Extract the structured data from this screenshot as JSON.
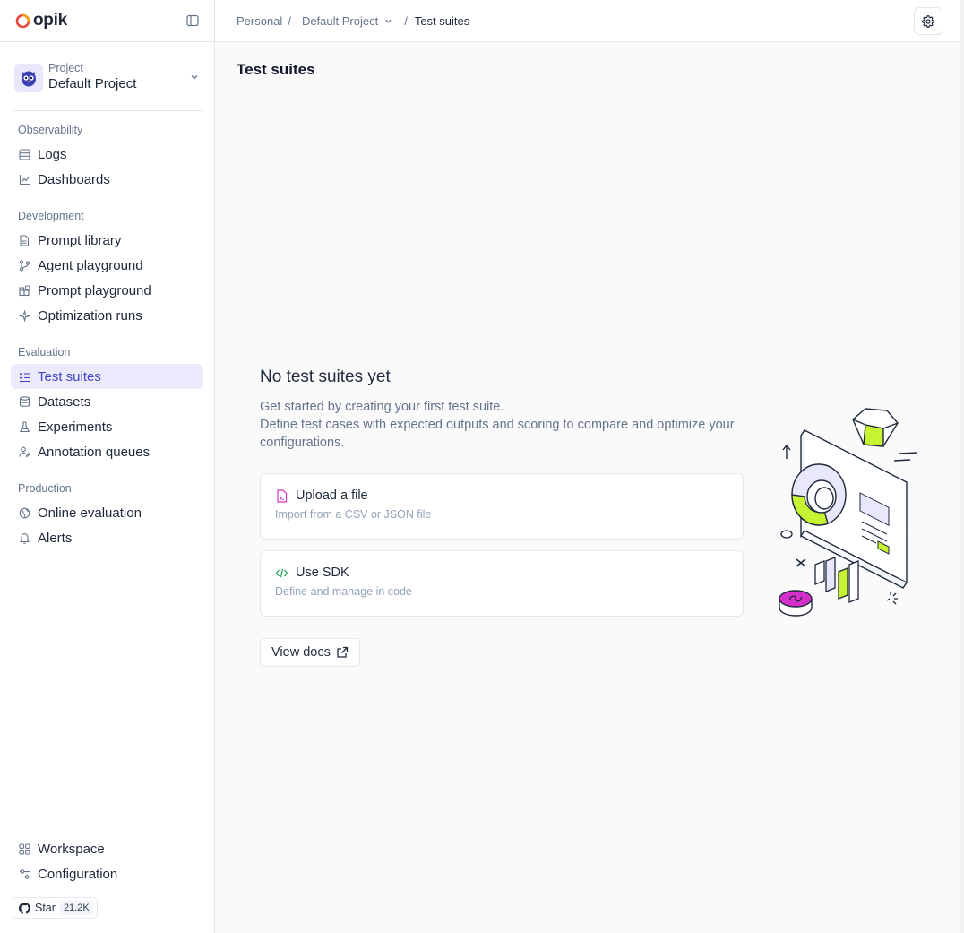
{
  "app": {
    "name": "opik"
  },
  "project": {
    "caption": "Project",
    "name": "Default Project"
  },
  "nav": {
    "observability": {
      "title": "Observability",
      "items": [
        "Logs",
        "Dashboards"
      ]
    },
    "development": {
      "title": "Development",
      "items": [
        "Prompt library",
        "Agent playground",
        "Prompt playground",
        "Optimization runs"
      ]
    },
    "evaluation": {
      "title": "Evaluation",
      "items": [
        "Test suites",
        "Datasets",
        "Experiments",
        "Annotation queues"
      ]
    },
    "production": {
      "title": "Production",
      "items": [
        "Online evaluation",
        "Alerts"
      ]
    },
    "bottom": [
      "Workspace",
      "Configuration"
    ],
    "active": "Test suites"
  },
  "github": {
    "label": "Star",
    "count": "21.2K"
  },
  "breadcrumb": {
    "workspace": "Personal",
    "project": "Default Project",
    "page": "Test suites"
  },
  "page": {
    "title": "Test suites"
  },
  "empty_state": {
    "title": "No test suites yet",
    "line1": "Get started by creating your first test suite.",
    "line2": "Define test cases with expected outputs and scoring to compare and optimize your configurations.",
    "cards": [
      {
        "title": "Upload a file",
        "subtitle": "Import from a CSV or JSON file"
      },
      {
        "title": "Use SDK",
        "subtitle": "Define and manage in code"
      }
    ],
    "docs_label": "View docs"
  },
  "colors": {
    "accent": "#4346c2",
    "active_bg": "#ebebfd",
    "logo_ring": "#e8483b",
    "green": "#c6f432",
    "magenta": "#d62fc9"
  }
}
